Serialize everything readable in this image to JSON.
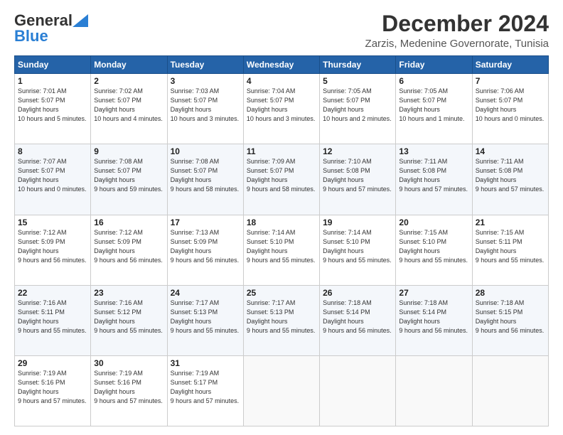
{
  "header": {
    "logo_line1": "General",
    "logo_line2": "Blue",
    "month": "December 2024",
    "location": "Zarzis, Medenine Governorate, Tunisia"
  },
  "weekdays": [
    "Sunday",
    "Monday",
    "Tuesday",
    "Wednesday",
    "Thursday",
    "Friday",
    "Saturday"
  ],
  "weeks": [
    [
      {
        "day": "1",
        "sunrise": "7:01 AM",
        "sunset": "5:07 PM",
        "daylight": "10 hours and 5 minutes."
      },
      {
        "day": "2",
        "sunrise": "7:02 AM",
        "sunset": "5:07 PM",
        "daylight": "10 hours and 4 minutes."
      },
      {
        "day": "3",
        "sunrise": "7:03 AM",
        "sunset": "5:07 PM",
        "daylight": "10 hours and 3 minutes."
      },
      {
        "day": "4",
        "sunrise": "7:04 AM",
        "sunset": "5:07 PM",
        "daylight": "10 hours and 3 minutes."
      },
      {
        "day": "5",
        "sunrise": "7:05 AM",
        "sunset": "5:07 PM",
        "daylight": "10 hours and 2 minutes."
      },
      {
        "day": "6",
        "sunrise": "7:05 AM",
        "sunset": "5:07 PM",
        "daylight": "10 hours and 1 minute."
      },
      {
        "day": "7",
        "sunrise": "7:06 AM",
        "sunset": "5:07 PM",
        "daylight": "10 hours and 0 minutes."
      }
    ],
    [
      {
        "day": "8",
        "sunrise": "7:07 AM",
        "sunset": "5:07 PM",
        "daylight": "10 hours and 0 minutes."
      },
      {
        "day": "9",
        "sunrise": "7:08 AM",
        "sunset": "5:07 PM",
        "daylight": "9 hours and 59 minutes."
      },
      {
        "day": "10",
        "sunrise": "7:08 AM",
        "sunset": "5:07 PM",
        "daylight": "9 hours and 58 minutes."
      },
      {
        "day": "11",
        "sunrise": "7:09 AM",
        "sunset": "5:07 PM",
        "daylight": "9 hours and 58 minutes."
      },
      {
        "day": "12",
        "sunrise": "7:10 AM",
        "sunset": "5:08 PM",
        "daylight": "9 hours and 57 minutes."
      },
      {
        "day": "13",
        "sunrise": "7:11 AM",
        "sunset": "5:08 PM",
        "daylight": "9 hours and 57 minutes."
      },
      {
        "day": "14",
        "sunrise": "7:11 AM",
        "sunset": "5:08 PM",
        "daylight": "9 hours and 57 minutes."
      }
    ],
    [
      {
        "day": "15",
        "sunrise": "7:12 AM",
        "sunset": "5:09 PM",
        "daylight": "9 hours and 56 minutes."
      },
      {
        "day": "16",
        "sunrise": "7:12 AM",
        "sunset": "5:09 PM",
        "daylight": "9 hours and 56 minutes."
      },
      {
        "day": "17",
        "sunrise": "7:13 AM",
        "sunset": "5:09 PM",
        "daylight": "9 hours and 56 minutes."
      },
      {
        "day": "18",
        "sunrise": "7:14 AM",
        "sunset": "5:10 PM",
        "daylight": "9 hours and 55 minutes."
      },
      {
        "day": "19",
        "sunrise": "7:14 AM",
        "sunset": "5:10 PM",
        "daylight": "9 hours and 55 minutes."
      },
      {
        "day": "20",
        "sunrise": "7:15 AM",
        "sunset": "5:10 PM",
        "daylight": "9 hours and 55 minutes."
      },
      {
        "day": "21",
        "sunrise": "7:15 AM",
        "sunset": "5:11 PM",
        "daylight": "9 hours and 55 minutes."
      }
    ],
    [
      {
        "day": "22",
        "sunrise": "7:16 AM",
        "sunset": "5:11 PM",
        "daylight": "9 hours and 55 minutes."
      },
      {
        "day": "23",
        "sunrise": "7:16 AM",
        "sunset": "5:12 PM",
        "daylight": "9 hours and 55 minutes."
      },
      {
        "day": "24",
        "sunrise": "7:17 AM",
        "sunset": "5:13 PM",
        "daylight": "9 hours and 55 minutes."
      },
      {
        "day": "25",
        "sunrise": "7:17 AM",
        "sunset": "5:13 PM",
        "daylight": "9 hours and 55 minutes."
      },
      {
        "day": "26",
        "sunrise": "7:18 AM",
        "sunset": "5:14 PM",
        "daylight": "9 hours and 56 minutes."
      },
      {
        "day": "27",
        "sunrise": "7:18 AM",
        "sunset": "5:14 PM",
        "daylight": "9 hours and 56 minutes."
      },
      {
        "day": "28",
        "sunrise": "7:18 AM",
        "sunset": "5:15 PM",
        "daylight": "9 hours and 56 minutes."
      }
    ],
    [
      {
        "day": "29",
        "sunrise": "7:19 AM",
        "sunset": "5:16 PM",
        "daylight": "9 hours and 57 minutes."
      },
      {
        "day": "30",
        "sunrise": "7:19 AM",
        "sunset": "5:16 PM",
        "daylight": "9 hours and 57 minutes."
      },
      {
        "day": "31",
        "sunrise": "7:19 AM",
        "sunset": "5:17 PM",
        "daylight": "9 hours and 57 minutes."
      },
      null,
      null,
      null,
      null
    ]
  ]
}
